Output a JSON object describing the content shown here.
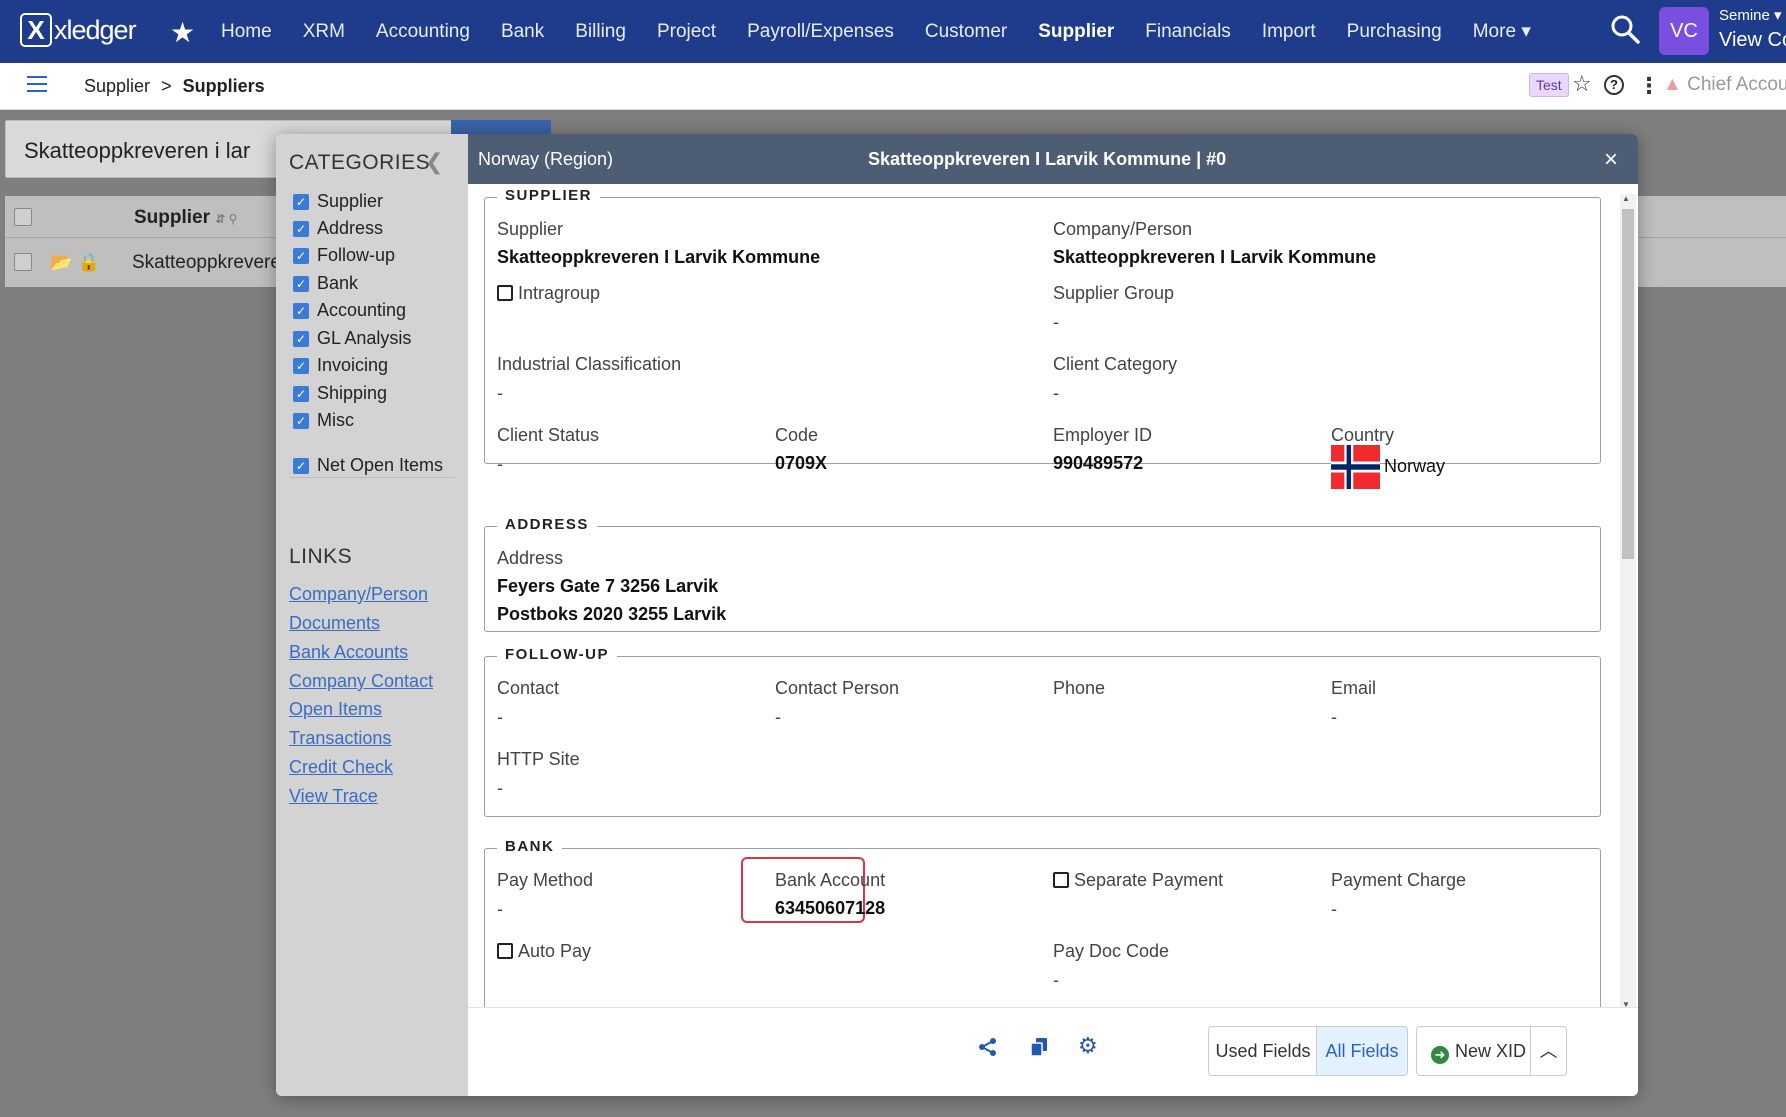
{
  "topnav": {
    "logo_mark": "X",
    "logo_text": "xledger",
    "items": [
      "Home",
      "XRM",
      "Accounting",
      "Bank",
      "Billing",
      "Project",
      "Payroll/Expenses",
      "Customer",
      "Supplier",
      "Financials",
      "Import",
      "Purchasing",
      "More"
    ],
    "active_index": 8,
    "more_caret": "▾",
    "avatar_initials": "VC",
    "user_name": "Semine ▾",
    "user_view": "View Co",
    "brand_color": "#1f3c8c"
  },
  "subbar": {
    "breadcrumb_parent": "Supplier",
    "breadcrumb_sep": ">",
    "breadcrumb_current": "Suppliers",
    "badge": "Test",
    "role": "Chief Accou"
  },
  "background": {
    "search_value": "Skatteoppkreveren i lar",
    "column_header": "Supplier",
    "row_value": "Skatteoppkrevere"
  },
  "categories": {
    "title": "CATEGORIES",
    "items": [
      "Supplier",
      "Address",
      "Follow-up",
      "Bank",
      "Accounting",
      "GL Analysis",
      "Invoicing",
      "Shipping",
      "Misc"
    ],
    "extra": "Net Open Items"
  },
  "links": {
    "title": "LINKS",
    "items": [
      "Company/Person",
      "Documents",
      "Bank Accounts",
      "Company Contact",
      "Open Items",
      "Transactions",
      "Credit Check",
      "View Trace"
    ]
  },
  "detail": {
    "region": "Norway (Region)",
    "title": "Skatteoppkreveren I Larvik Kommune | #0",
    "supplier_section": {
      "legend": "SUPPLIER",
      "supplier_label": "Supplier",
      "supplier_value": "Skatteoppkreveren I Larvik Kommune",
      "company_label": "Company/Person",
      "company_value": "Skatteoppkreveren I Larvik Kommune",
      "intragroup_label": "Intragroup",
      "supplier_group_label": "Supplier Group",
      "supplier_group_value": "-",
      "industrial_label": "Industrial Classification",
      "industrial_value": "-",
      "client_category_label": "Client Category",
      "client_category_value": "-",
      "client_status_label": "Client Status",
      "client_status_value": "-",
      "code_label": "Code",
      "code_value": "0709X",
      "employer_label": "Employer ID",
      "employer_value": "990489572",
      "country_label": "Country",
      "country_value": "Norway"
    },
    "address_section": {
      "legend": "ADDRESS",
      "address_label": "Address",
      "line1": "Feyers Gate 7 3256 Larvik",
      "line2": "Postboks 2020 3255 Larvik"
    },
    "followup_section": {
      "legend": "FOLLOW-UP",
      "contact_label": "Contact",
      "contact_value": "-",
      "contact_person_label": "Contact Person",
      "contact_person_value": "-",
      "phone_label": "Phone",
      "email_label": "Email",
      "email_value": "-",
      "http_label": "HTTP Site",
      "http_value": "-"
    },
    "bank_section": {
      "legend": "BANK",
      "pay_method_label": "Pay Method",
      "pay_method_value": "-",
      "bank_account_label": "Bank Account",
      "bank_account_value": "63450607128",
      "separate_payment_label": "Separate Payment",
      "payment_charge_label": "Payment Charge",
      "payment_charge_value": "-",
      "auto_pay_label": "Auto Pay",
      "pay_doc_label": "Pay Doc Code",
      "pay_doc_value": "-"
    },
    "footer": {
      "used_fields": "Used Fields",
      "all_fields": "All Fields",
      "new_xid": "New XID"
    }
  }
}
